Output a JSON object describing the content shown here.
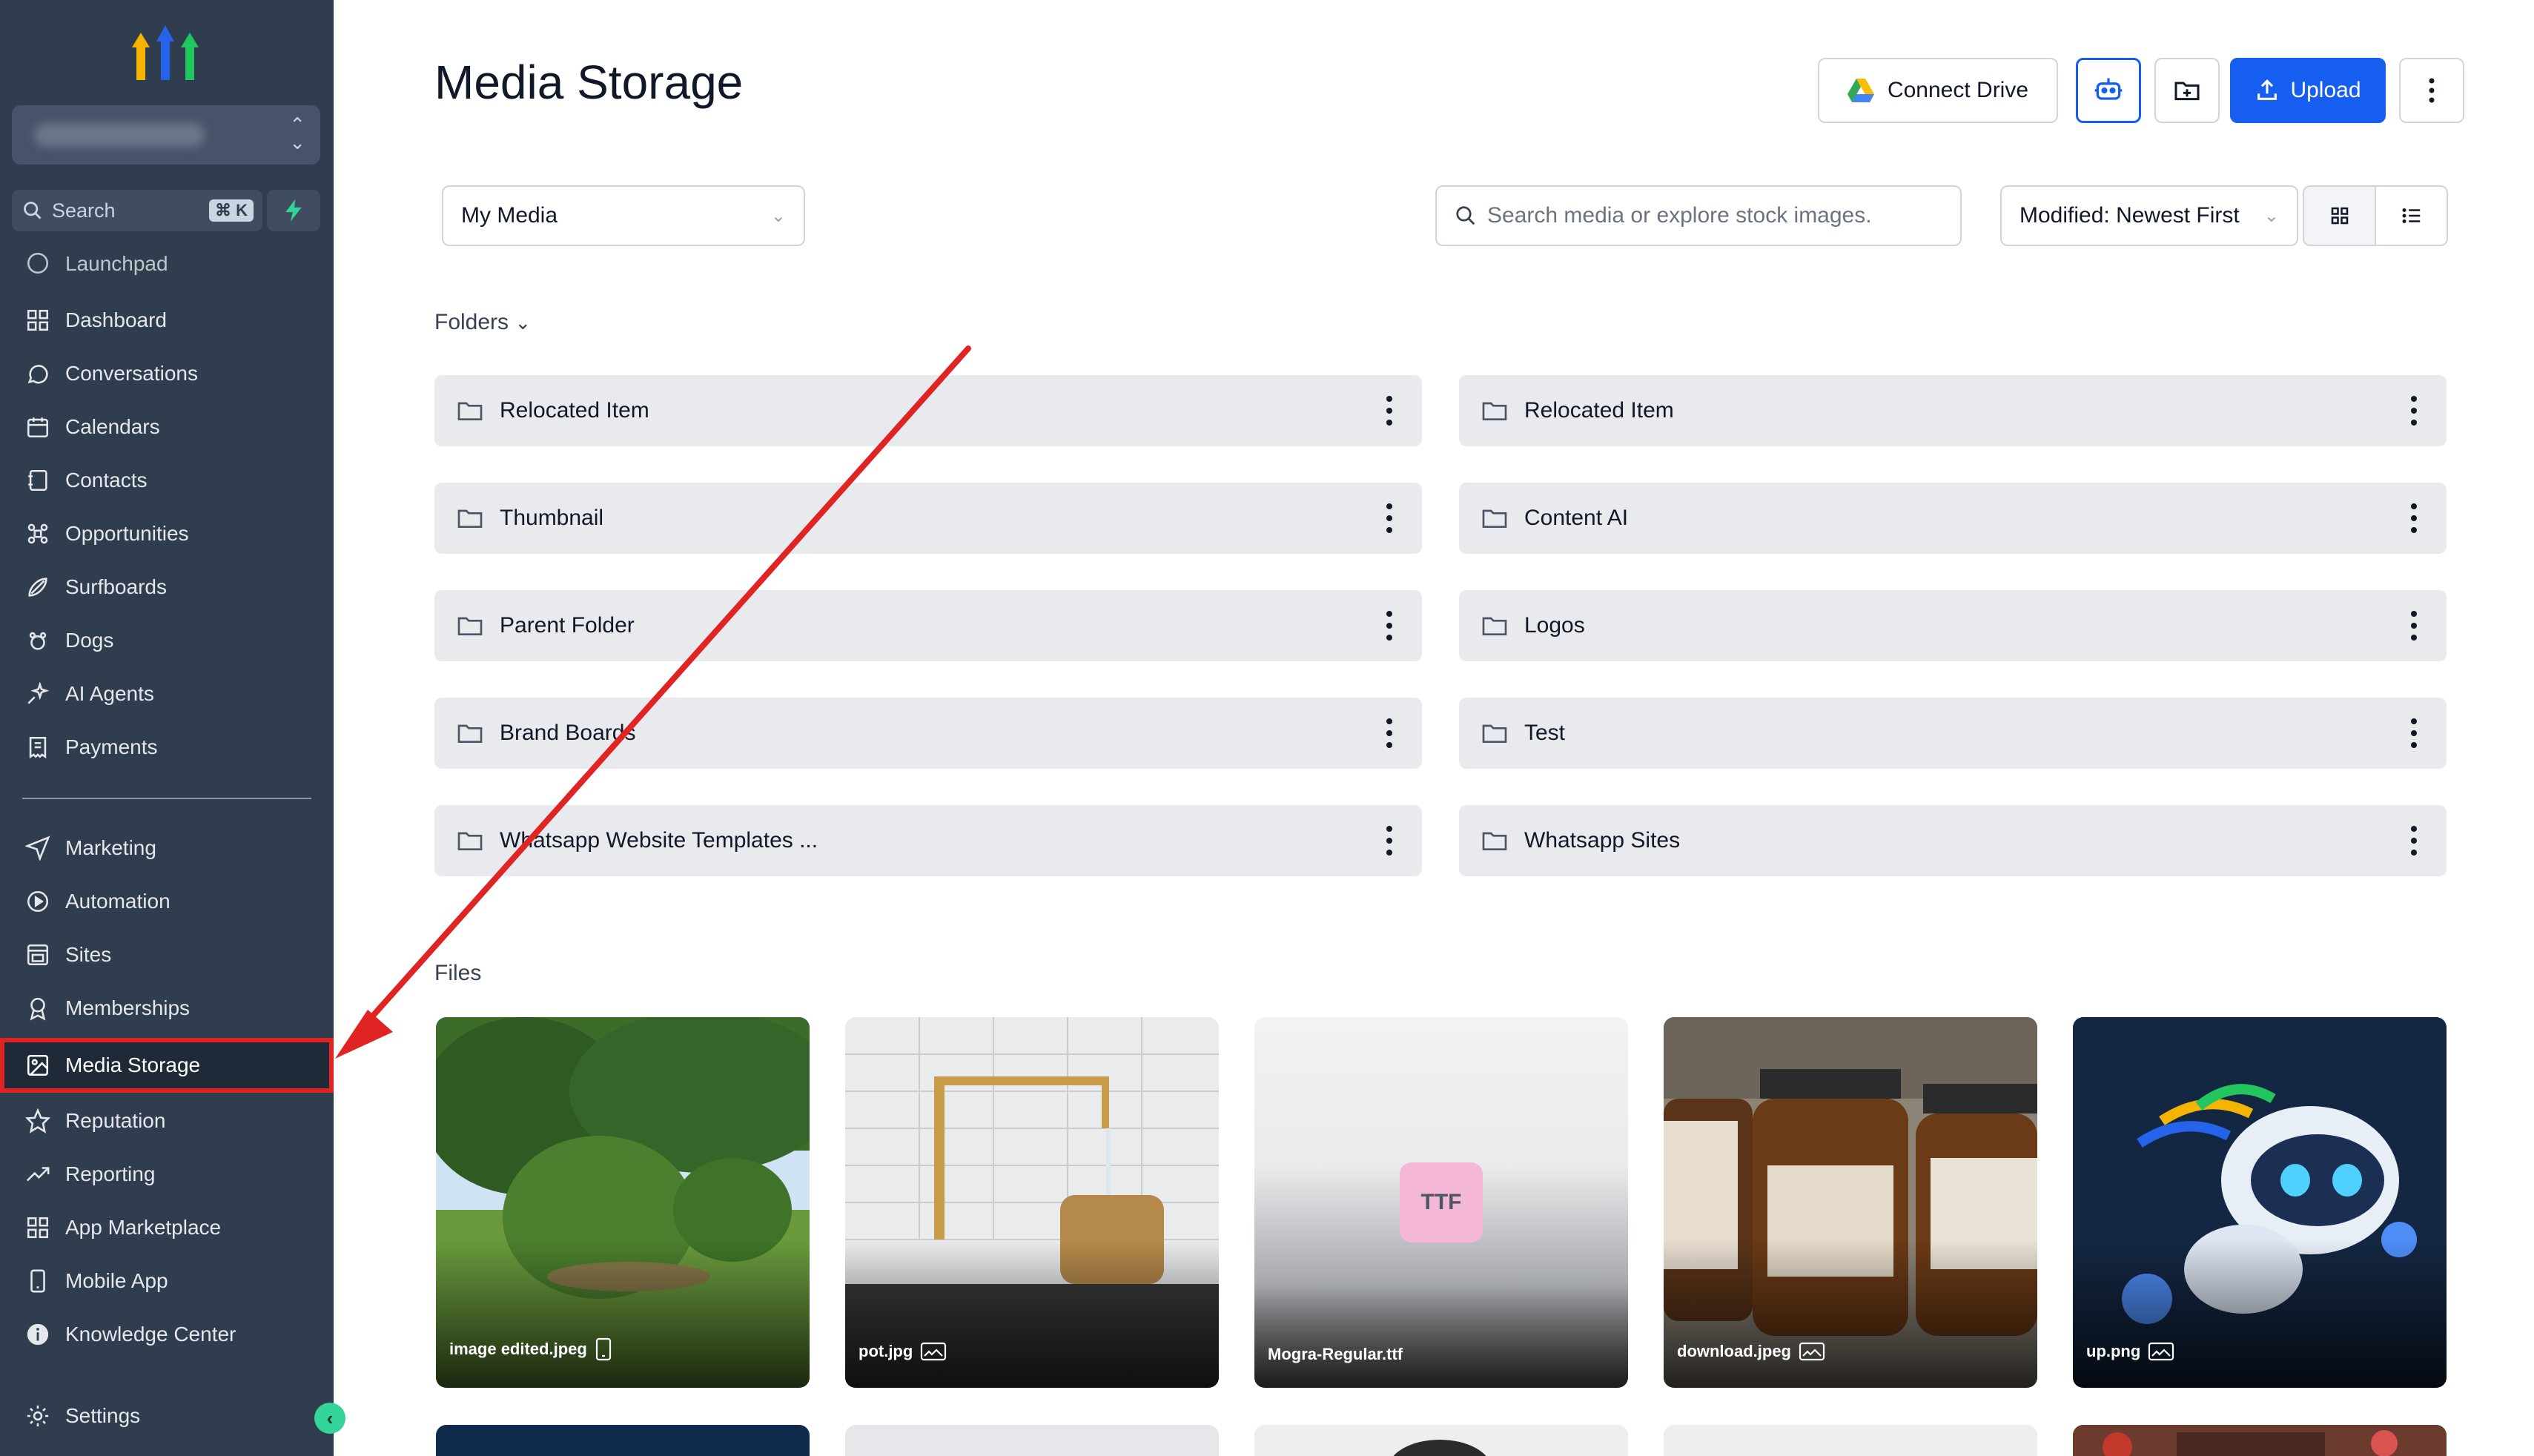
{
  "sidebar": {
    "search_label": "Search",
    "search_shortcut": "⌘ K",
    "items_top": [
      {
        "label": "Launchpad",
        "icon": "rocket-icon"
      },
      {
        "label": "Dashboard",
        "icon": "grid-icon"
      },
      {
        "label": "Conversations",
        "icon": "chat-icon"
      },
      {
        "label": "Calendars",
        "icon": "calendar-icon"
      },
      {
        "label": "Contacts",
        "icon": "contacts-icon"
      },
      {
        "label": "Opportunities",
        "icon": "opportunities-icon"
      },
      {
        "label": "Surfboards",
        "icon": "surfboard-icon"
      },
      {
        "label": "Dogs",
        "icon": "paw-icon"
      },
      {
        "label": "AI Agents",
        "icon": "sparkle-icon"
      },
      {
        "label": "Payments",
        "icon": "receipt-icon"
      }
    ],
    "items_bottom": [
      {
        "label": "Marketing",
        "icon": "send-icon"
      },
      {
        "label": "Automation",
        "icon": "automation-icon"
      },
      {
        "label": "Sites",
        "icon": "sites-icon"
      },
      {
        "label": "Memberships",
        "icon": "badge-icon"
      },
      {
        "label": "Media Storage",
        "icon": "image-icon"
      },
      {
        "label": "Reputation",
        "icon": "star-icon"
      },
      {
        "label": "Reporting",
        "icon": "trend-icon"
      },
      {
        "label": "App Marketplace",
        "icon": "apps-icon"
      },
      {
        "label": "Mobile App",
        "icon": "phone-icon"
      },
      {
        "label": "Knowledge Center",
        "icon": "info-icon"
      }
    ],
    "settings_label": "Settings",
    "active_item": "Media Storage"
  },
  "header": {
    "title": "Media Storage",
    "connect_drive_label": "Connect Drive",
    "upload_label": "Upload"
  },
  "toolbar": {
    "scope_select": "My Media",
    "search_placeholder": "Search media or explore stock images.",
    "sort_select": "Modified: Newest First"
  },
  "folders_label": "Folders",
  "folders": [
    "Relocated Item",
    "Relocated Item",
    "Thumbnail",
    "Content AI",
    "Parent Folder",
    "Logos",
    "Brand Boards",
    "Test",
    "Whatsapp Website Templates ...",
    "Whatsapp Sites"
  ],
  "files_label": "Files",
  "files": [
    {
      "name": "image edited.jpeg",
      "type_icon": "phone-file-icon"
    },
    {
      "name": "pot.jpg",
      "type_icon": "image-file-icon"
    },
    {
      "name": "Mogra-Regular.ttf",
      "badge": "TTF"
    },
    {
      "name": "download.jpeg",
      "type_icon": "image-file-icon"
    },
    {
      "name": "up.png",
      "type_icon": "image-file-icon"
    }
  ],
  "colors": {
    "sidebar_bg": "#2f3d4e",
    "primary": "#155eef",
    "annotation_red": "#e02424"
  }
}
